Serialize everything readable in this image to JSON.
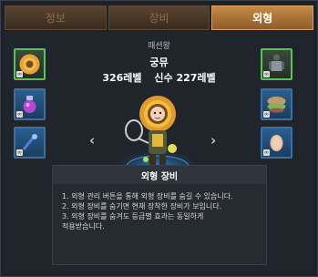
{
  "tabs": [
    {
      "label": "정보",
      "active": false
    },
    {
      "label": "장비",
      "active": false
    },
    {
      "label": "외형",
      "active": true
    }
  ],
  "header": {
    "subtitle": "패션왕",
    "character_name": "궁뮤",
    "level": "326레벨",
    "divine_level": "신수 227레벨"
  },
  "nav": {
    "prev_icon": "chevron-left-icon",
    "next_icon": "chevron-right-icon"
  },
  "left_slots": [
    {
      "icon": "sunflower-hat-icon",
      "highlight": "green"
    },
    {
      "icon": "potion-icon",
      "highlight": "blue"
    },
    {
      "icon": "wand-icon",
      "highlight": "blue"
    }
  ],
  "right_slots": [
    {
      "icon": "armor-icon",
      "highlight": "green"
    },
    {
      "icon": "shoes-icon",
      "highlight": "blue"
    },
    {
      "icon": "face-icon",
      "highlight": "blue"
    }
  ],
  "info": {
    "heading": "외형 장비",
    "lines": [
      "1. 외형 관리 버튼을 통해 외형 장비를 숨길 수 있습니다.",
      "2. 외형 장비를 숨기면 현재 장착한 장비가 보입니다.",
      "3. 외형 장비를 숨겨도 등급별 효과는 동일하게",
      "적용받습니다."
    ]
  },
  "colors": {
    "active_tab": "#c58a45",
    "inactive_tab": "#5a4330",
    "slot_blue": "#2a5f8f",
    "slot_green_border": "#59c35a"
  }
}
